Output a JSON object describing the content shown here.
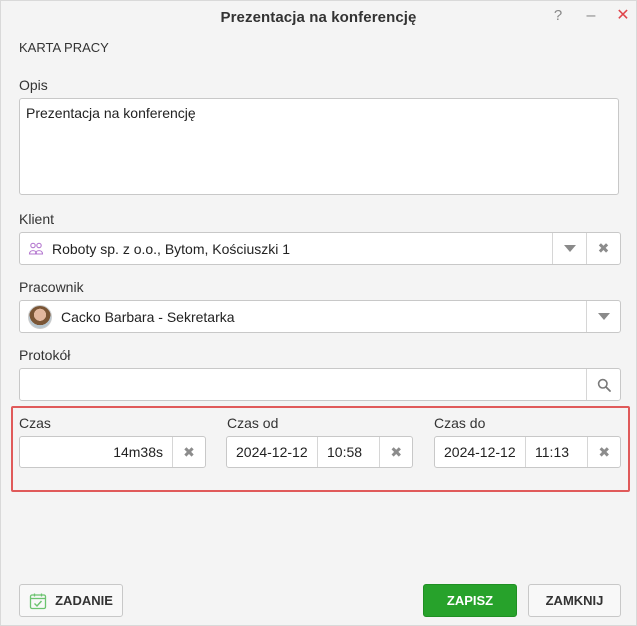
{
  "window": {
    "title": "Prezentacja na konferencję",
    "help_label": "?",
    "minimize_label": "–",
    "close_label": "✕"
  },
  "section": {
    "title": "KARTA PRACY"
  },
  "opis": {
    "label": "Opis",
    "value": "Prezentacja na konferencję"
  },
  "klient": {
    "label": "Klient",
    "value": "Roboty sp. z o.o., Bytom, Kościuszki 1",
    "icon": "client-icon"
  },
  "pracownik": {
    "label": "Pracownik",
    "value": "Cacko Barbara - Sekretarka",
    "icon": "avatar"
  },
  "protokol": {
    "label": "Protokół",
    "value": "",
    "icon": "search-icon"
  },
  "czas": {
    "label": "Czas",
    "value": "14m38s"
  },
  "czas_od": {
    "label": "Czas od",
    "date": "2024-12-12",
    "time": "10:58"
  },
  "czas_do": {
    "label": "Czas do",
    "date": "2024-12-12",
    "time": "11:13"
  },
  "footer": {
    "zadanie_label": "ZADANIE",
    "zapisz_label": "ZAPISZ",
    "zamknij_label": "ZAMKNIJ"
  },
  "colors": {
    "primary_green": "#27a22b",
    "highlight_red": "#e05a5a"
  }
}
